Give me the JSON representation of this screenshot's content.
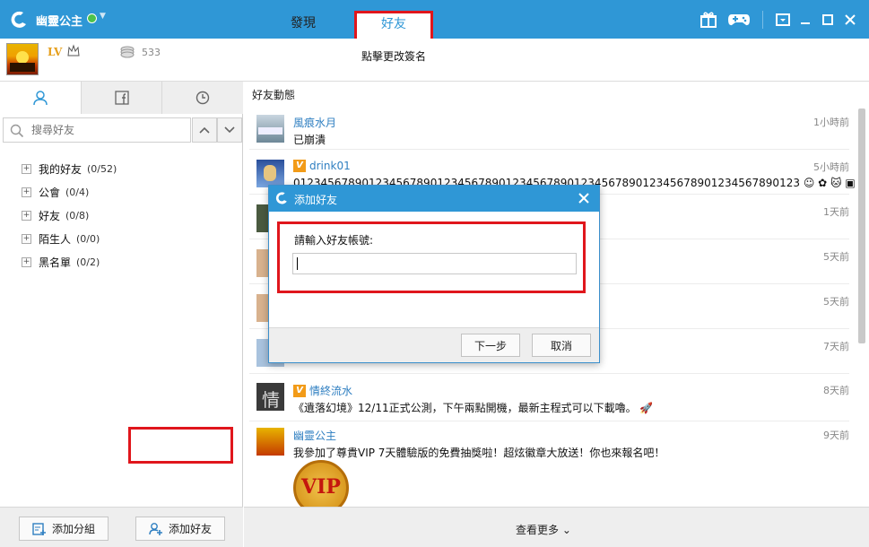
{
  "titlebar": {
    "username": "幽靈公主",
    "tabs": [
      {
        "label": "發現"
      },
      {
        "label": "好友"
      }
    ],
    "icons": [
      "gift-icon",
      "gamepad-icon",
      "dropdown-menu-icon",
      "minimize-icon",
      "maximize-icon",
      "close-icon"
    ]
  },
  "profile": {
    "lv": "LV",
    "coins": "533",
    "signature_prompt": "點擊更改簽名"
  },
  "sidebar": {
    "tabs": [
      "person-icon",
      "facebook-icon",
      "clock-icon"
    ],
    "search_placeholder": "搜尋好友",
    "groups": [
      {
        "name": "我的好友",
        "count": "(0/52)"
      },
      {
        "name": "公會",
        "count": "(0/4)"
      },
      {
        "name": "好友",
        "count": "(0/8)"
      },
      {
        "name": "陌生人",
        "count": "(0/0)"
      },
      {
        "name": "黑名單",
        "count": "(0/2)"
      }
    ],
    "add_group_label": "添加分組",
    "add_friend_label": "添加好友"
  },
  "feed": {
    "title": "好友動態",
    "items": [
      {
        "name": "風痕水月",
        "text": "已崩潰",
        "time": "1小時前",
        "vip": false
      },
      {
        "name": "drink01",
        "text": "01234567890123456789012345678901234567890123456789012345678901234567890123",
        "time": "5小時前",
        "vip": true
      },
      {
        "name": "",
        "text": "",
        "time": "1天前",
        "vip": false
      },
      {
        "name": "",
        "text": "",
        "time": "5天前",
        "vip": false
      },
      {
        "name": "",
        "text": "",
        "time": "5天前",
        "vip": false
      },
      {
        "name": "",
        "text": "",
        "time": "7天前",
        "vip": false
      },
      {
        "name": "情終流水",
        "text": "《遺落幻境》12/11正式公測，下午兩點開機，最新主程式可以下載嚕。",
        "time": "8天前",
        "vip": true
      },
      {
        "name": "幽靈公主",
        "text": "我參加了尊貴VIP 7天體驗版的免費抽獎啦！超炫徽章大放送！你也來報名吧！",
        "time": "9天前",
        "vip": false
      }
    ],
    "vip_badge": "VIP",
    "more_label": "查看更多"
  },
  "dialog": {
    "title": "添加好友",
    "prompt": "請輸入好友帳號:",
    "input_value": "",
    "next_label": "下一步",
    "cancel_label": "取消"
  },
  "colors": {
    "brand_blue": "#2f97d6",
    "highlight_red": "#e0161c",
    "link_blue": "#2f7fc1"
  }
}
